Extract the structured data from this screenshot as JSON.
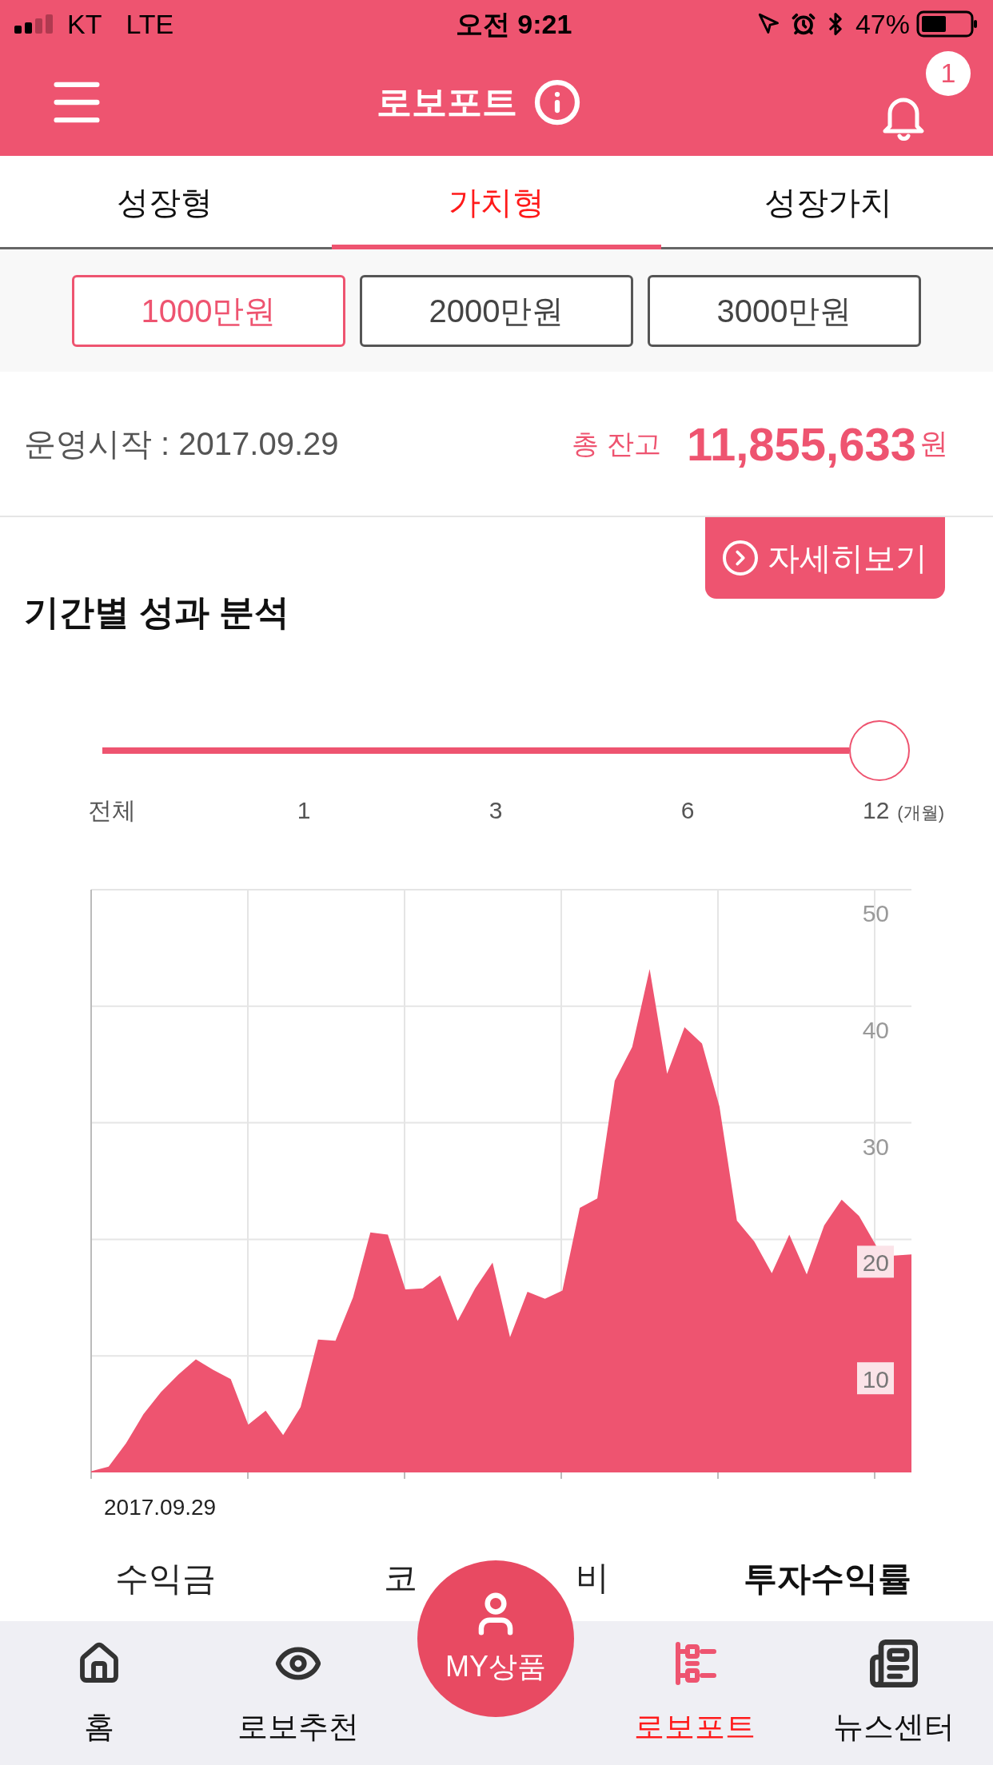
{
  "status_bar": {
    "carrier": "KT",
    "network": "LTE",
    "time": "오전 9:21",
    "battery": "47%"
  },
  "header": {
    "title": "로보포트",
    "notification_count": "1"
  },
  "tabs": [
    {
      "label": "성장형",
      "selected": false
    },
    {
      "label": "가치형",
      "selected": true
    },
    {
      "label": "성장가치",
      "selected": false
    }
  ],
  "amount_options": [
    {
      "label": "1000만원",
      "selected": true
    },
    {
      "label": "2000만원",
      "selected": false
    },
    {
      "label": "3000만원",
      "selected": false
    }
  ],
  "summary": {
    "start": "운영시작 : 2017.09.29",
    "balance_label": "총 잔고",
    "balance": "11,855,633",
    "unit": "원"
  },
  "detail_button": "자세히보기",
  "section_title": "기간별 성과 분석",
  "period_slider": {
    "level": 1,
    "ticks": [
      "전체",
      "1",
      "3",
      "6",
      "12"
    ],
    "unit": "(개월)"
  },
  "chart_data": {
    "type": "area",
    "ylim": [
      0,
      50
    ],
    "yticks": [
      10,
      20,
      30,
      40,
      50
    ],
    "grid": true,
    "series": [
      {
        "color": "#ee5470",
        "values": [
          0.1,
          0.5,
          2.5,
          5.0,
          6.9,
          8.4,
          9.7,
          8.8,
          8.0,
          4.1,
          5.3,
          3.2,
          5.6,
          11.4,
          11.3,
          15.0,
          20.6,
          20.4,
          15.7,
          15.8,
          16.9,
          13.0,
          15.8,
          18.0,
          11.6,
          15.5,
          14.9,
          15.6,
          22.7,
          23.5,
          33.6,
          36.5,
          43.2,
          34.2,
          38.2,
          36.8,
          31.4,
          21.6,
          19.8,
          17.1,
          20.4,
          17.0,
          21.2,
          23.4,
          22.0,
          19.4,
          18.6,
          18.7
        ]
      }
    ]
  },
  "chart_start_date": "2017.09.29",
  "chart_tabs": [
    {
      "label": "수익금",
      "selected": false
    },
    {
      "label": "코",
      "label_end": "비",
      "selected": false
    },
    {
      "label": "투자수익률",
      "selected": true
    }
  ],
  "my_button": "MY상품",
  "nav": [
    {
      "label": "홈",
      "selected": false
    },
    {
      "label": "로보추천",
      "selected": false
    },
    {
      "label": "로보포트",
      "selected": true
    },
    {
      "label": "뉴스센터",
      "selected": false
    }
  ]
}
